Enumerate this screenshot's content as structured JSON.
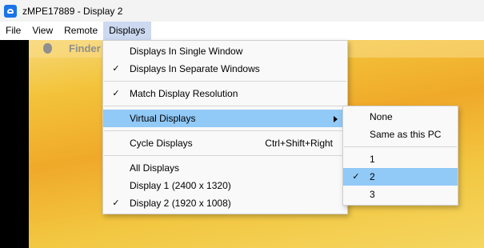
{
  "window": {
    "title": "zMPE17889 - Display 2"
  },
  "menubar": {
    "items": [
      "File",
      "View",
      "Remote",
      "Displays"
    ]
  },
  "remote": {
    "mac_menubar_app": "Finder"
  },
  "displays_menu": {
    "single_window": "Displays In Single Window",
    "separate_windows": "Displays In Separate Windows",
    "match_resolution": "Match Display Resolution",
    "virtual_displays": "Virtual Displays",
    "cycle_displays": "Cycle Displays",
    "cycle_shortcut": "Ctrl+Shift+Right",
    "all_displays": "All Displays",
    "display_1": "Display 1 (2400 x 1320)",
    "display_2": "Display 2 (1920 x 1008)"
  },
  "virtual_menu": {
    "none": "None",
    "same_as_pc": "Same as this PC",
    "opt_1": "1",
    "opt_2": "2",
    "opt_3": "3"
  },
  "glyphs": {
    "check": "✓"
  },
  "colors": {
    "highlight": "#91c9f7",
    "desktop_accent": "#f3c33a"
  }
}
